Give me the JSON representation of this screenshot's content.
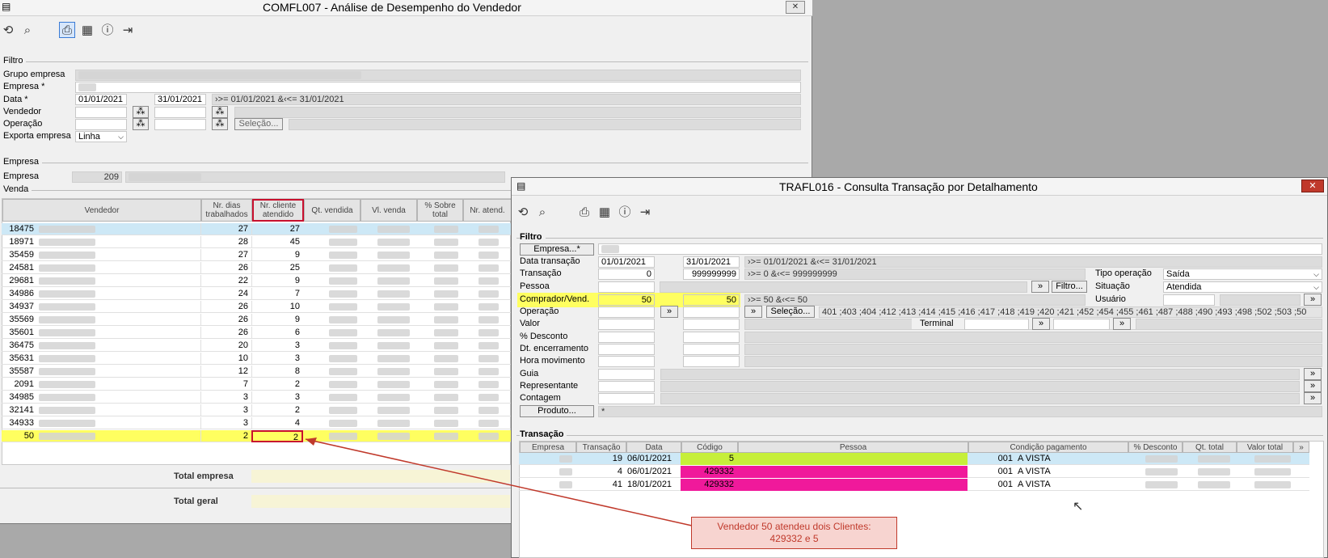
{
  "win1": {
    "title": "COMFL007 - Análise de Desempenho do Vendedor",
    "filtro_label": "Filtro",
    "grupo_label": "Grupo empresa",
    "empresa_label": "Empresa *",
    "data_label": "Data *",
    "data_ini": "01/01/2021",
    "data_fim": "31/01/2021",
    "data_expr": "›>= 01/01/2021  &‹<= 31/01/2021",
    "vendedor_label": "Vendedor",
    "operacao_label": "Operação",
    "selecao_btn": "Seleção...",
    "exporta_label": "Exporta empresa",
    "exporta_value": "Linha",
    "empresa_group": "Empresa",
    "empresa_field_label": "Empresa",
    "empresa_code": "209",
    "venda_group": "Venda",
    "headers": [
      "Vendedor",
      "Nr. dias trabalhados",
      "Nr. cliente atendido",
      "Qt. vendida",
      "Vl. venda",
      "% Sobre total",
      "Nr. atend."
    ],
    "rows": [
      {
        "code": "18475",
        "dias": "27",
        "cli": "27"
      },
      {
        "code": "18971",
        "dias": "28",
        "cli": "45"
      },
      {
        "code": "35459",
        "dias": "27",
        "cli": "9"
      },
      {
        "code": "24581",
        "dias": "26",
        "cli": "25"
      },
      {
        "code": "29681",
        "dias": "22",
        "cli": "9"
      },
      {
        "code": "34986",
        "dias": "24",
        "cli": "7"
      },
      {
        "code": "34937",
        "dias": "26",
        "cli": "10"
      },
      {
        "code": "35569",
        "dias": "26",
        "cli": "9"
      },
      {
        "code": "35601",
        "dias": "26",
        "cli": "6"
      },
      {
        "code": "36475",
        "dias": "20",
        "cli": "3"
      },
      {
        "code": "35631",
        "dias": "10",
        "cli": "3"
      },
      {
        "code": "35587",
        "dias": "12",
        "cli": "8"
      },
      {
        "code": "2091",
        "dias": "7",
        "cli": "2"
      },
      {
        "code": "34985",
        "dias": "3",
        "cli": "3"
      },
      {
        "code": "32141",
        "dias": "3",
        "cli": "2"
      },
      {
        "code": "34933",
        "dias": "3",
        "cli": "4"
      },
      {
        "code": "50",
        "dias": "2",
        "cli": "2"
      }
    ],
    "total_empresa": "Total empresa",
    "total_geral": "Total geral"
  },
  "win2": {
    "title": "TRAFL016 - Consulta Transação por Detalhamento",
    "filtro_label": "Filtro",
    "empresa_btn": "Empresa...*",
    "data_transacao_label": "Data transação",
    "data_ini": "01/01/2021",
    "data_fim": "31/01/2021",
    "data_expr": "›>= 01/01/2021  &‹<= 31/01/2021",
    "transacao_label": "Transação",
    "trans_ini": "0",
    "trans_fim": "999999999",
    "trans_expr": "›>= 0  &‹<= 999999999",
    "tipo_op_label": "Tipo operação",
    "tipo_op_value": "Saída",
    "pessoa_label": "Pessoa",
    "filtro_btn": "Filtro...",
    "situacao_label": "Situação",
    "situacao_value": "Atendida",
    "comprador_label": "Comprador/Vend.",
    "comp_ini": "50",
    "comp_fim": "50",
    "comp_expr": "›>= 50  &‹<= 50",
    "usuario_label": "Usuário",
    "operacao_label": "Operação",
    "selecao_btn": "Seleção...",
    "operacao_list": "401 ;403 ;404 ;412 ;413 ;414 ;415 ;416 ;417 ;418 ;419 ;420 ;421 ;452 ;454 ;455 ;461 ;487 ;488 ;490 ;493 ;498 ;502 ;503 ;50",
    "valor_label": "Valor",
    "terminal_label": "Terminal",
    "desconto_label": "% Desconto",
    "dt_enc_label": "Dt. encerramento",
    "hora_label": "Hora movimento",
    "guia_label": "Guia",
    "representante_label": "Representante",
    "contagem_label": "Contagem",
    "produto_btn": "Produto...",
    "produto_value": "*",
    "transacao_group": "Transação",
    "headers": [
      "Empresa",
      "Transação",
      "Data",
      "Código",
      "Pessoa",
      "Condição pagamento",
      "% Desconto",
      "Qt. total",
      "Valor total"
    ],
    "rows": [
      {
        "trans": "19",
        "data": "06/01/2021",
        "codigo": "5",
        "cond_code": "001",
        "cond": "A VISTA"
      },
      {
        "trans": "4",
        "data": "06/01/2021",
        "codigo": "429332",
        "cond_code": "001",
        "cond": "A VISTA"
      },
      {
        "trans": "41",
        "data": "18/01/2021",
        "codigo": "429332",
        "cond_code": "001",
        "cond": "A VISTA"
      }
    ]
  },
  "note": {
    "line1": "Vendedor 50 atendeu dois Clientes:",
    "line2": "429332 e 5"
  }
}
